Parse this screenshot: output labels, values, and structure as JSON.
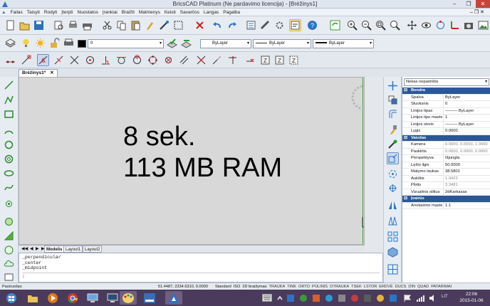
{
  "app": {
    "title": "BricsCAD Platinum (Ne pardavimo licencija) - [Brėžinys1]",
    "logo_icon": "bricscad-logo-icon"
  },
  "menu": [
    "Failas",
    "Taisyti",
    "Rodyti",
    "Įterpti",
    "Nuostatos",
    "Įrankiai",
    "Braižti",
    "Matmenys",
    "Keisti",
    "Savarčos",
    "Langas",
    "Pagalba"
  ],
  "toolbar2": {
    "layer_value": "0",
    "color_value": "ByLayer",
    "linetype_value": "ByLayer",
    "lineweight_value": "ByLayer"
  },
  "document": {
    "tab": "Brėžinys1*",
    "canvas_line1": "8 sek.",
    "canvas_line2": "113 MB RAM"
  },
  "layout_tabs": [
    "Modelis",
    "Layout1",
    "Layout2"
  ],
  "command_lines": [
    "_perpendicular",
    "_center",
    "_midpoint",
    ":"
  ],
  "properties": {
    "selector": "Nekas neparinkta",
    "rows": [
      {
        "type": "cat",
        "label": "Bendra"
      },
      {
        "type": "row",
        "label": "Spalva",
        "value": "ByLayer"
      },
      {
        "type": "row",
        "label": "Sluoksnis",
        "value": "0"
      },
      {
        "type": "row",
        "label": "Linijos tipas",
        "value": "——— ByLayer"
      },
      {
        "type": "row",
        "label": "Linijos tipo mastel",
        "value": "1"
      },
      {
        "type": "row",
        "label": "Linijos storis",
        "value": "——— ByLayer"
      },
      {
        "type": "row",
        "label": "Lygis",
        "value": "0.0000"
      },
      {
        "type": "cat",
        "label": "Vaizdas"
      },
      {
        "type": "row",
        "label": "Kamera",
        "value": "0.0000, 0.0000, 1.0000",
        "dim": true
      },
      {
        "type": "row",
        "label": "Paskirtis",
        "value": "0.0000, 0.0000, 0.0000",
        "dim": true
      },
      {
        "type": "row",
        "label": "Perspektyva",
        "value": "Išjungta"
      },
      {
        "type": "row",
        "label": "Lęšio ilgis",
        "value": "50.0000"
      },
      {
        "type": "row",
        "label": "Matymo laukas",
        "value": "38.5801"
      },
      {
        "type": "row",
        "label": "Aukštis",
        "value": "1.9423",
        "dim": true
      },
      {
        "type": "row",
        "label": "Plotis",
        "value": "3.3481",
        "dim": true
      },
      {
        "type": "row",
        "label": "Vizualinis stilius",
        "value": "2dKarkasas"
      },
      {
        "type": "cat",
        "label": "Įvairūs"
      },
      {
        "type": "row",
        "label": "Anotavimo mastel",
        "value": "1:1"
      }
    ]
  },
  "status": {
    "left": "Pasiruošęs",
    "coords": "51.4487, 2234.6310, 0.0000",
    "items": [
      "Standard",
      "ISO",
      "2D braižymas",
      "TRAUKA",
      "TINK",
      "ORTO",
      "POLINIS",
      "OTRAUKA",
      "TSEK",
      "LSTOR",
      "ERDVĖ",
      "DUCS",
      "DIN",
      "QUAD",
      "PATARIMAI"
    ]
  },
  "taskbar": {
    "lang": "LIT",
    "time": "22:06",
    "date": "2015-01-06"
  },
  "colors": {
    "accent": "#2b5797",
    "canvas": "#d8d8d8",
    "taskbar": "#4a3a5c"
  }
}
